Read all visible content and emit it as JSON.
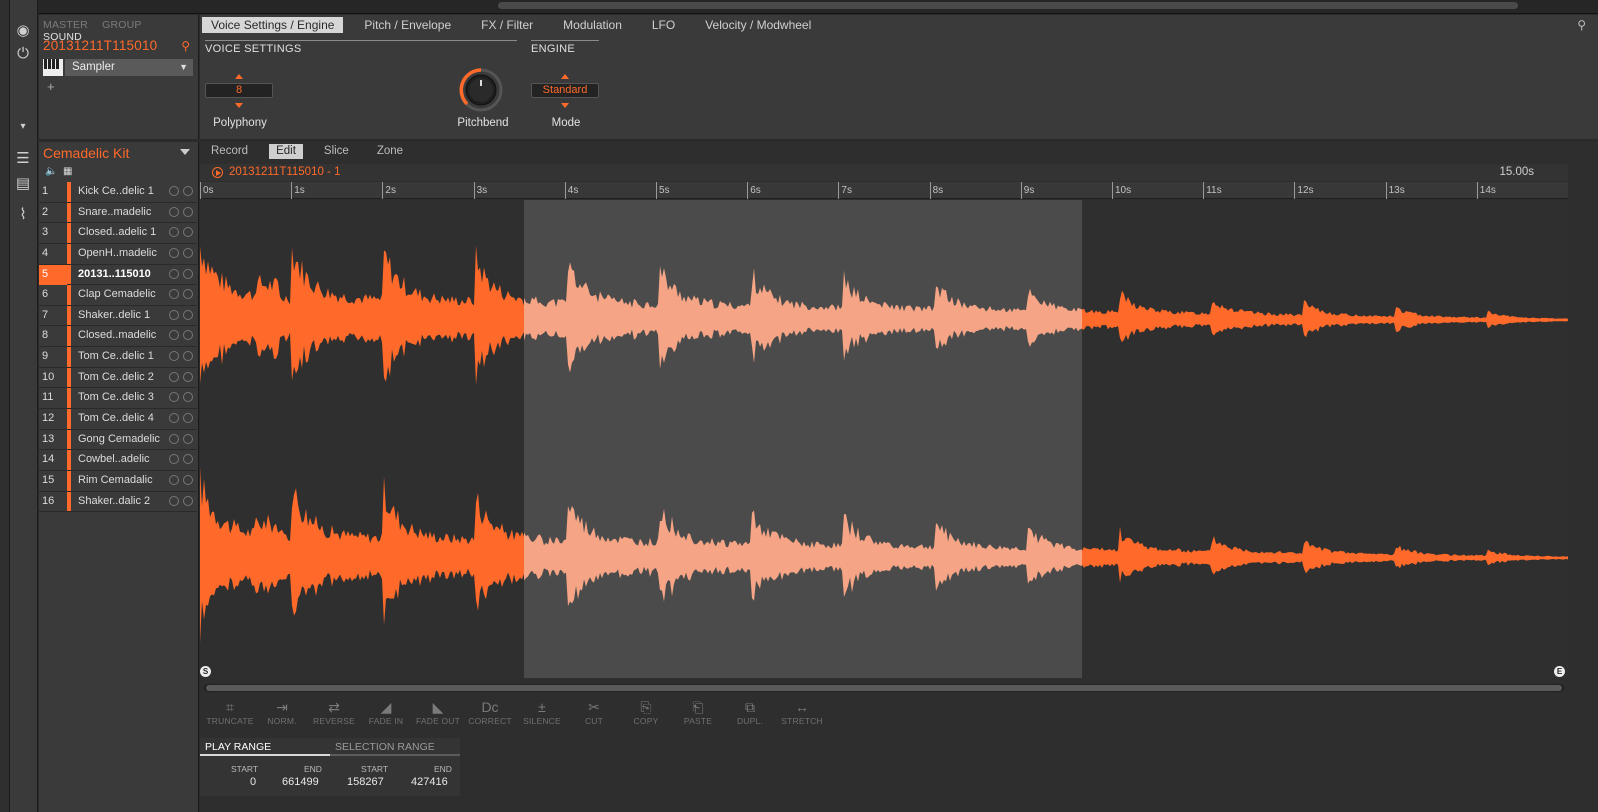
{
  "leftbar": {
    "icons": [
      "record-icon",
      "plug-icon",
      "list-icon",
      "grid-icon",
      "waveform-icon"
    ]
  },
  "soundpanel": {
    "tabs": [
      {
        "label": "MASTER",
        "active": false
      },
      {
        "label": "GROUP",
        "active": false
      },
      {
        "label": "SOUND",
        "active": true
      }
    ],
    "sound_name": "20131211T115010",
    "plugin": "Sampler",
    "add": "+"
  },
  "main": {
    "tabs": [
      {
        "label": "Voice Settings / Engine",
        "active": true
      },
      {
        "label": "Pitch / Envelope",
        "active": false
      },
      {
        "label": "FX / Filter",
        "active": false
      },
      {
        "label": "Modulation",
        "active": false
      },
      {
        "label": "LFO",
        "active": false
      },
      {
        "label": "Velocity / Modwheel",
        "active": false
      }
    ],
    "voice_settings_title": "VOICE SETTINGS",
    "engine_title": "ENGINE",
    "polyphony": {
      "value": "8",
      "label": "Polyphony"
    },
    "pitchbend": {
      "label": "Pitchbend"
    },
    "mode": {
      "value": "Standard",
      "label": "Mode"
    }
  },
  "kit": {
    "name": "Cemadelic Kit",
    "pads": [
      {
        "n": "1",
        "name": "Kick Ce..delic 1"
      },
      {
        "n": "2",
        "name": "Snare..madelic"
      },
      {
        "n": "3",
        "name": "Closed..adelic 1"
      },
      {
        "n": "4",
        "name": "OpenH..madelic"
      },
      {
        "n": "5",
        "name": "20131..115010",
        "selected": true
      },
      {
        "n": "6",
        "name": "Clap Cemadelic"
      },
      {
        "n": "7",
        "name": "Shaker..delic 1"
      },
      {
        "n": "8",
        "name": "Closed..madelic"
      },
      {
        "n": "9",
        "name": "Tom Ce..delic 1"
      },
      {
        "n": "10",
        "name": "Tom Ce..delic 2"
      },
      {
        "n": "11",
        "name": "Tom Ce..delic 3"
      },
      {
        "n": "12",
        "name": "Tom Ce..delic 4"
      },
      {
        "n": "13",
        "name": "Gong Cemadelic"
      },
      {
        "n": "14",
        "name": "Cowbel..adelic"
      },
      {
        "n": "15",
        "name": "Rim Cemadalic"
      },
      {
        "n": "16",
        "name": "Shaker..dalic 2"
      }
    ]
  },
  "editor": {
    "tabs": [
      {
        "label": "Record"
      },
      {
        "label": "Edit",
        "active": true
      },
      {
        "label": "Slice"
      },
      {
        "label": "Zone"
      }
    ],
    "sample_name": "20131211T115010 - 1",
    "duration": "15.00s",
    "ruler": [
      "0s",
      "1s",
      "2s",
      "3s",
      "4s",
      "5s",
      "6s",
      "7s",
      "8s",
      "9s",
      "10s",
      "11s",
      "12s",
      "13s",
      "14s"
    ],
    "markers": {
      "start": "S",
      "end": "E"
    },
    "tools": [
      "TRUNCATE",
      "NORM.",
      "REVERSE",
      "FADE IN",
      "FADE OUT",
      "CORRECT",
      "SILENCE",
      "CUT",
      "COPY",
      "PASTE",
      "DUPL.",
      "STRETCH"
    ],
    "play_range": {
      "title": "PLAY RANGE",
      "start_label": "START",
      "end_label": "END",
      "start": "0",
      "end": "661499"
    },
    "selection_range": {
      "title": "SELECTION RANGE",
      "start_label": "START",
      "end_label": "END",
      "start": "158267",
      "end": "427416"
    }
  },
  "colors": {
    "accent": "#ff6a2a",
    "wave_selected": "#f5a585",
    "bg": "#2e2e2e",
    "selection_band": "#4b4b4b"
  }
}
